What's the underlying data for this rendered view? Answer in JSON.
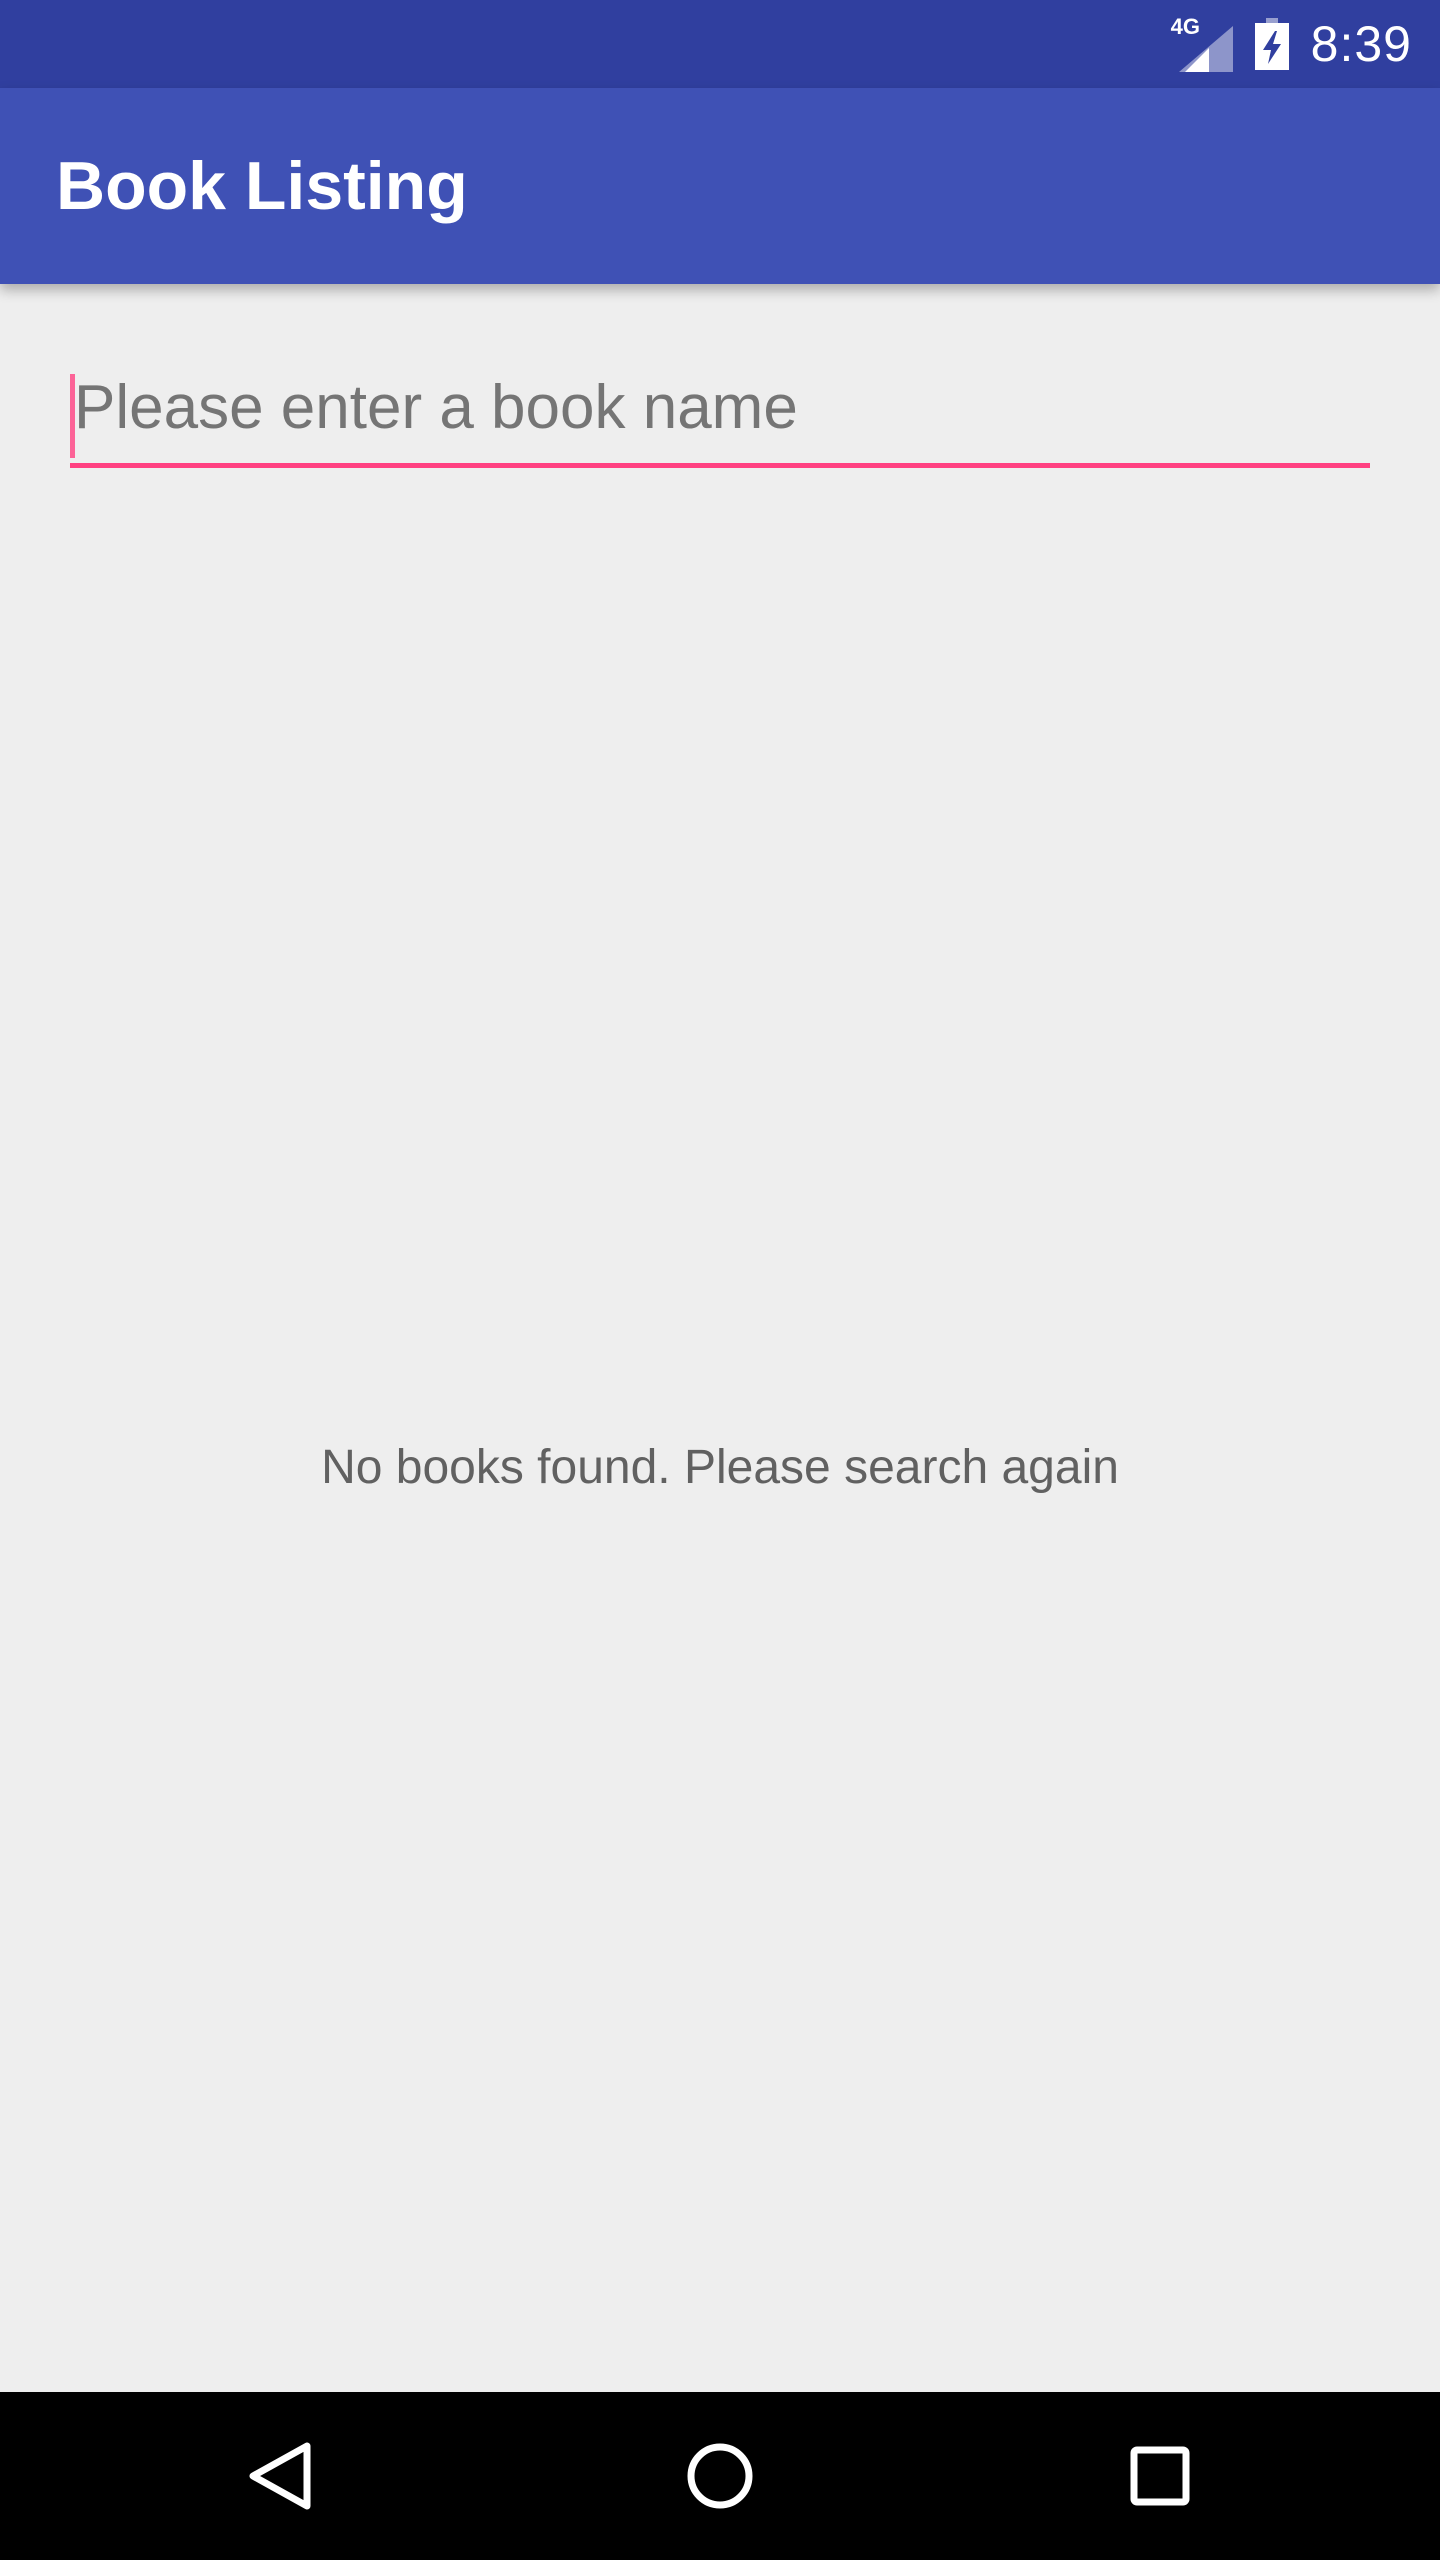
{
  "status_bar": {
    "network_label": "4G",
    "time": "8:39",
    "icons": [
      "signal-icon",
      "battery-charging-icon"
    ]
  },
  "app_bar": {
    "title": "Book Listing"
  },
  "search": {
    "value": "",
    "placeholder": "Please enter a book name"
  },
  "empty_state": {
    "message": "No books found. Please search again"
  },
  "nav_bar": {
    "buttons": [
      "back-icon",
      "home-icon",
      "recents-icon"
    ]
  },
  "colors": {
    "status_bar": "#303f9f",
    "app_bar": "#3f51b5",
    "accent": "#ff4081",
    "background": "#eeeeee"
  }
}
